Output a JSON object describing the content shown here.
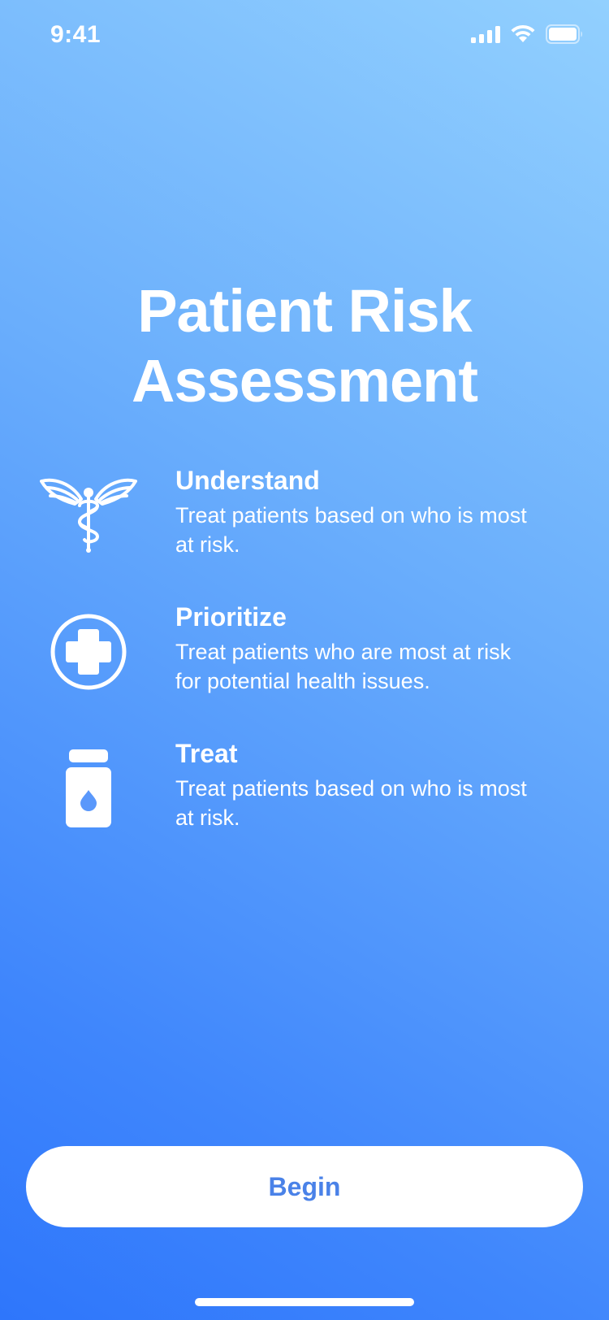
{
  "status_bar": {
    "time": "9:41",
    "icons": [
      "cellular-signal-icon",
      "wifi-icon",
      "battery-icon"
    ]
  },
  "title": {
    "line1": "Patient Risk",
    "line2": "Assessment"
  },
  "features": [
    {
      "icon": "caduceus-icon",
      "heading": "Understand",
      "desc_line1": "Treat patients based on who is most",
      "desc_line2": "at risk."
    },
    {
      "icon": "medical-cross-icon",
      "heading": "Prioritize",
      "desc_line1": "Treat patients who are most at risk",
      "desc_line2": "for potential health issues."
    },
    {
      "icon": "medicine-bottle-icon",
      "heading": "Treat",
      "desc_line1": "Treat patients based on who is most",
      "desc_line2": "at risk."
    }
  ],
  "begin_button": {
    "label": "Begin"
  },
  "colors": {
    "gradient_top_right": "#92d0fe",
    "gradient_bottom_left": "#2e76fb",
    "button_text": "#4a82e8",
    "text": "#ffffff"
  }
}
